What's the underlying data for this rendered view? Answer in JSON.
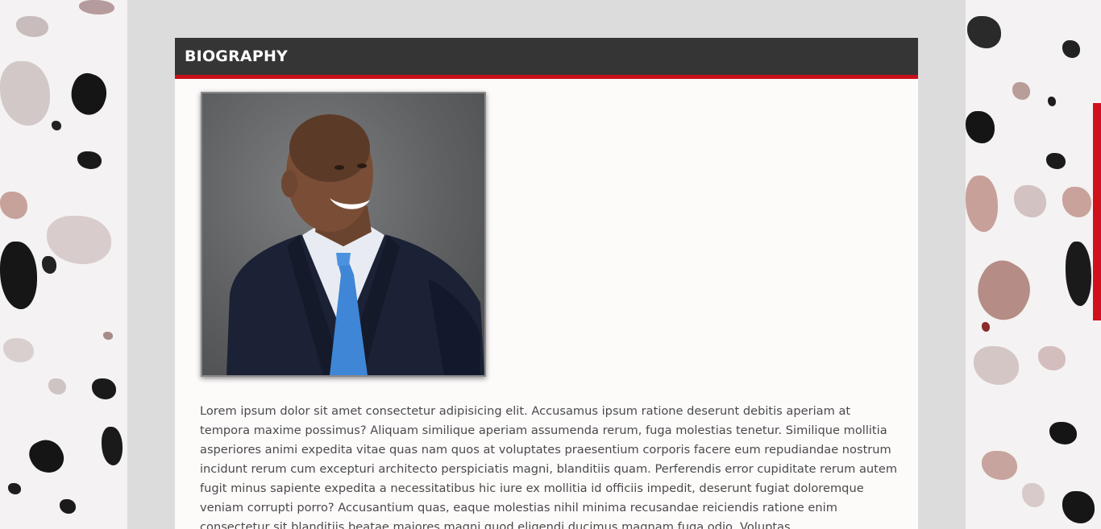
{
  "section": {
    "title": "BIOGRAPHY"
  },
  "bio": {
    "paragraph": "Lorem ipsum dolor sit amet consectetur adipisicing elit. Accusamus ipsum ratione deserunt debitis aperiam at tempora maxime possimus? Aliquam similique aperiam assumenda rerum, fuga molestias tenetur. Similique mollitia asperiores animi expedita vitae quas nam quos at voluptates praesentium corporis facere eum repudiandae nostrum incidunt rerum cum excepturi architecto perspiciatis magni, blanditiis quam. Perferendis error cupiditate rerum autem fugit minus sapiente expedita a necessitatibus hic iure ex mollitia id officiis impedit, deserunt fugiat doloremque veniam corrupti porro? Accusantium quas, eaque molestias nihil minima recusandae reiciendis ratione enim consectetur sit blanditiis beatae maiores magni quod eligendi ducimus magnam fuga odio. Voluptas"
  },
  "colors": {
    "header_bg": "#353535",
    "accent": "#c8101a",
    "page_bg": "#dcdcdc",
    "card_bg": "#fdfafa"
  }
}
